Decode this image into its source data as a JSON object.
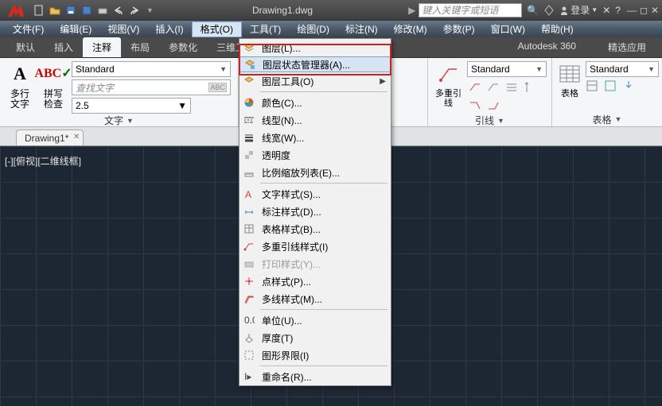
{
  "title": "Drawing1.dwg",
  "search_placeholder": "键入关键字或短语",
  "login_label": "登录",
  "menubar": [
    "文件(F)",
    "编辑(E)",
    "视图(V)",
    "插入(I)",
    "格式(O)",
    "工具(T)",
    "绘图(D)",
    "标注(N)",
    "修改(M)",
    "参数(P)",
    "窗口(W)",
    "帮助(H)"
  ],
  "menubar_open_index": 4,
  "ribbon_tabs": [
    "默认",
    "插入",
    "注释",
    "布局",
    "参数化",
    "三维工具"
  ],
  "ribbon_tabs_right": [
    "Autodesk 360",
    "精选应用"
  ],
  "ribbon_tab_active": 2,
  "panel_text": {
    "mtext_top": "多行",
    "mtext_bottom": "文字",
    "check_top": "拼写",
    "check_bottom": "检查",
    "style": "Standard",
    "find": "查找文字",
    "height": "2.5",
    "title": "文字"
  },
  "panel_leader": {
    "btn": "多重引线",
    "style": "Standard",
    "title": "引线"
  },
  "panel_table": {
    "btn": "表格",
    "style": "Standard",
    "title": "表格"
  },
  "filetab": "Drawing1*",
  "viewport_label": "[-][俯视][二维线框]",
  "dropdown": [
    {
      "label": "图层(L)...",
      "icon": "layers",
      "type": "item"
    },
    {
      "label": "图层状态管理器(A)...",
      "icon": "layerstate",
      "type": "item",
      "hover": true
    },
    {
      "label": "图层工具(O)",
      "icon": "layertools",
      "type": "sub"
    },
    {
      "type": "sep"
    },
    {
      "label": "颜色(C)...",
      "icon": "color",
      "type": "item"
    },
    {
      "label": "线型(N)...",
      "icon": "linetype",
      "type": "item"
    },
    {
      "label": "线宽(W)...",
      "icon": "lineweight",
      "type": "item"
    },
    {
      "label": "透明度",
      "icon": "transparency",
      "type": "item"
    },
    {
      "label": "比例缩放列表(E)...",
      "icon": "scale",
      "type": "item"
    },
    {
      "type": "sep"
    },
    {
      "label": "文字样式(S)...",
      "icon": "textstyle",
      "type": "item"
    },
    {
      "label": "标注样式(D)...",
      "icon": "dimstyle",
      "type": "item"
    },
    {
      "label": "表格样式(B)...",
      "icon": "tablestyle",
      "type": "item"
    },
    {
      "label": "多重引线样式(I)",
      "icon": "mleaderstyle",
      "type": "item"
    },
    {
      "label": "打印样式(Y)...",
      "icon": "plotstyle",
      "type": "item",
      "disabled": true
    },
    {
      "label": "点样式(P)...",
      "icon": "pointstyle",
      "type": "item"
    },
    {
      "label": "多线样式(M)...",
      "icon": "mlinestyle",
      "type": "item"
    },
    {
      "type": "sep"
    },
    {
      "label": "单位(U)...",
      "icon": "units",
      "type": "item"
    },
    {
      "label": "厚度(T)",
      "icon": "thickness",
      "type": "item"
    },
    {
      "label": "图形界限(I)",
      "icon": "limits",
      "type": "item"
    },
    {
      "type": "sep"
    },
    {
      "label": "重命名(R)...",
      "icon": "rename",
      "type": "item"
    }
  ]
}
